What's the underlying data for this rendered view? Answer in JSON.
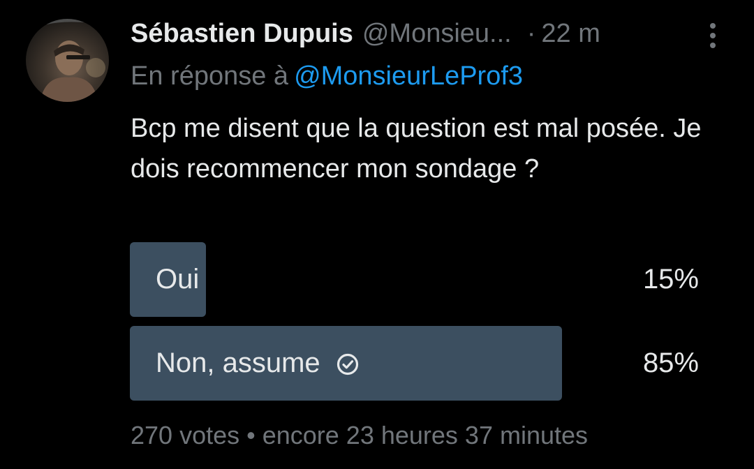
{
  "tweet": {
    "author_name": "Sébastien Dupuis",
    "author_handle": "@Monsieu...",
    "time_separator": "·",
    "time": "22 m",
    "reply_prefix": "En réponse à",
    "reply_to": "@MonsieurLeProf3",
    "text": "Bcp me disent que la question est mal posée. Je dois recommencer mon sondage ?"
  },
  "poll": {
    "options": [
      {
        "label": "Oui",
        "percent_label": "15%",
        "percent": 15,
        "selected": false
      },
      {
        "label": "Non, assume",
        "percent_label": "85%",
        "percent": 85,
        "selected": true
      }
    ],
    "votes": "270 votes",
    "separator": "•",
    "remaining": "encore 23 heures 37 minutes"
  },
  "icons": {
    "more": "more-vertical-icon",
    "selected_check": "check-circle-icon"
  },
  "colors": {
    "background": "#000000",
    "primary_text": "#e7e9ea",
    "secondary_text": "#71767b",
    "link": "#1d9bf0",
    "poll_bar": "#3c4f60"
  }
}
